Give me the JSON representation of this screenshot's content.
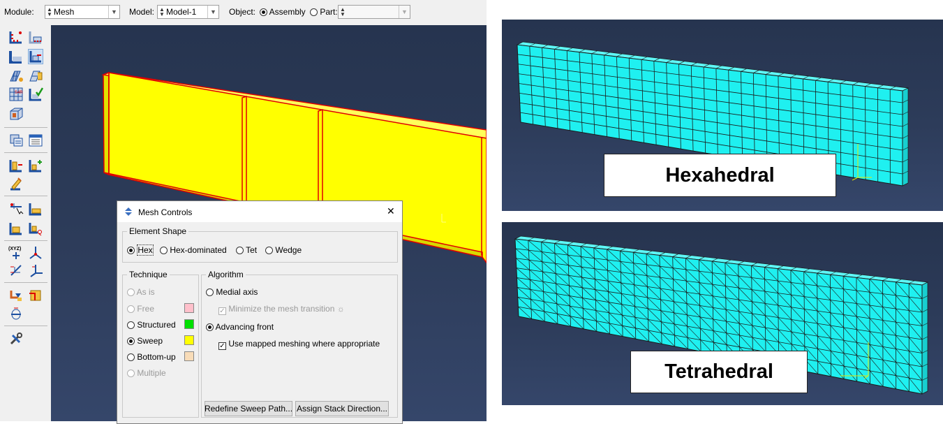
{
  "context_bar": {
    "module_label": "Module:",
    "module_value": "Mesh",
    "model_label": "Model:",
    "model_value": "Model-1",
    "object_label": "Object:",
    "assembly_label": "Assembly",
    "part_label": "Part:",
    "part_value": "",
    "object_selected": "Assembly"
  },
  "mesh_controls": {
    "title": "Mesh Controls",
    "element_shape": {
      "title": "Element Shape",
      "options": [
        "Hex",
        "Hex-dominated",
        "Tet",
        "Wedge"
      ],
      "selected": "Hex"
    },
    "technique": {
      "title": "Technique",
      "options": [
        "As is",
        "Free",
        "Structured",
        "Sweep",
        "Bottom-up",
        "Multiple"
      ],
      "selected": "Sweep",
      "disabled": [
        "As is",
        "Free",
        "Multiple"
      ],
      "swatch_colors": {
        "Free": "#ffc0cb",
        "Structured": "#00e000",
        "Sweep": "#ffff00",
        "Bottom-up": "#f8dcb8"
      }
    },
    "algorithm": {
      "title": "Algorithm",
      "medial_axis": "Medial axis",
      "minimize_transition": "Minimize the mesh transition",
      "advancing_front": "Advancing front",
      "mapped_meshing": "Use mapped meshing where appropriate",
      "selected": "Advancing front",
      "mapped_meshing_checked": true,
      "minimize_checked": true,
      "minimize_disabled": true
    },
    "buttons": {
      "redefine_sweep": "Redefine Sweep Path...",
      "assign_stack": "Assign Stack Direction..."
    },
    "close_glyph": "✕"
  },
  "panels": {
    "hex_label": "Hexahedral",
    "tet_label": "Tetrahedral"
  },
  "colors": {
    "part_fill": "#ffff00",
    "part_edge": "#e00000",
    "mesh_fill": "#1ff0f0",
    "mesh_line": "#1a1a1a",
    "viewport_bg": "#2d3c5a"
  },
  "toolbox_icons": [
    "seed-part-icon",
    "seed-edge-icon",
    "seed-part-instance-icon",
    "seed-edge-biased-icon",
    "mesh-controls-icon",
    "assign-element-type-icon",
    "mesh-part-icon",
    "verify-mesh-icon",
    "partition-cell-icon",
    "query-mesh-icon",
    "mesh-module-manager-icon",
    "edit-mesh-icon",
    "create-mesh-part-icon",
    "delete-mesh-icon",
    "virtual-topology-icon",
    "repair-geometry-icon",
    "combine-faces-icon",
    "split-edge-icon",
    "datum-point-icon",
    "datum-axis-icon",
    "datum-plane-icon",
    "datum-csys-icon",
    "assign-stack-icon",
    "sweep-path-icon",
    "feature-edge-icon",
    "tools-settings-icon"
  ]
}
